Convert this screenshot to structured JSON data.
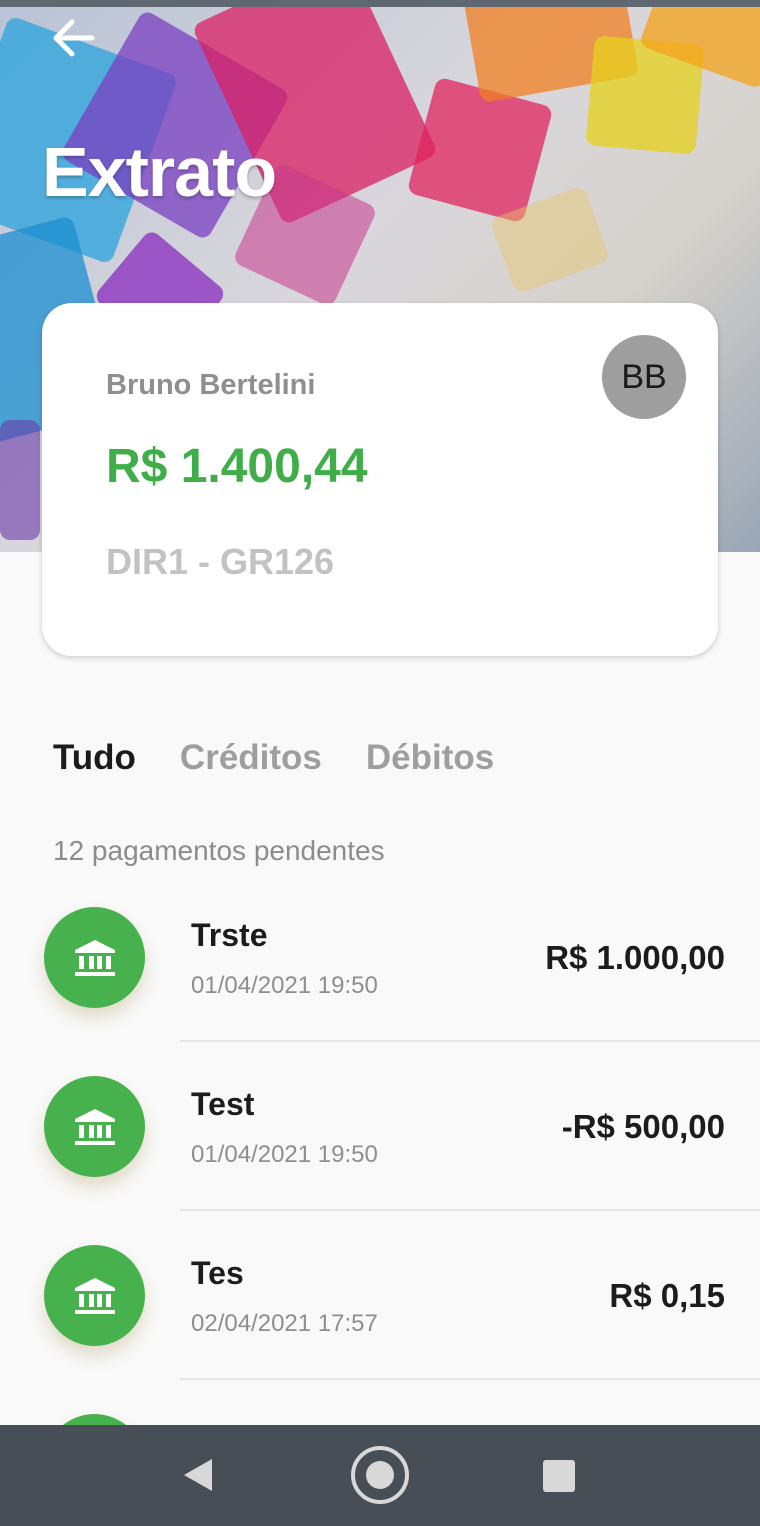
{
  "header": {
    "title": "Extrato"
  },
  "account": {
    "name": "Bruno Bertelini",
    "balance": "R$ 1.400,44",
    "group": "DIR1 - GR126",
    "avatar_initials": "BB"
  },
  "tabs": [
    {
      "label": "Tudo",
      "active": true
    },
    {
      "label": "Créditos",
      "active": false
    },
    {
      "label": "Débitos",
      "active": false
    }
  ],
  "pending_label": "12 pagamentos pendentes",
  "transactions": [
    {
      "title": "Trste",
      "date": "01/04/2021 19:50",
      "amount": "R$ 1.000,00",
      "icon": "bank-icon"
    },
    {
      "title": "Test",
      "date": "01/04/2021 19:50",
      "amount": "-R$ 500,00",
      "icon": "bank-icon"
    },
    {
      "title": "Tes",
      "date": "02/04/2021 17:57",
      "amount": "R$ 0,15",
      "icon": "bank-icon"
    }
  ],
  "colors": {
    "accent_green": "#47b24d",
    "balance_green": "#3fae49",
    "navbar": "#474e55"
  }
}
